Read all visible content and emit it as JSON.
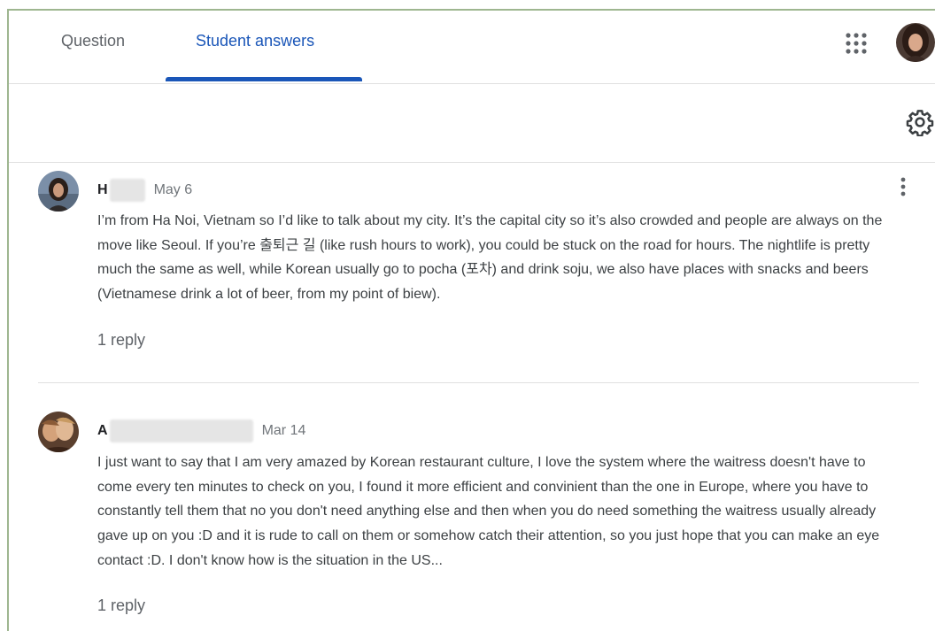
{
  "tabs": {
    "question": "Question",
    "student_answers": "Student answers",
    "active": "student_answers"
  },
  "icons": {
    "apps": "apps-grid-icon",
    "settings": "settings-gear-icon",
    "more": "more-vertical-icon",
    "user_avatar": "user-avatar-photo"
  },
  "colors": {
    "accent": "#1a56b8",
    "text": "#3c4043",
    "muted": "#5f6368",
    "frame_border": "#9eb690"
  },
  "posts": [
    {
      "author_initial": "H",
      "date": "May 6",
      "body": "I’m from Ha Noi, Vietnam so I’d like to talk about my city. It’s the capital city so it’s also crowded and people are always on the move like Seoul. If you’re 출퇴근 길 (like rush hours to work), you could be stuck on the road for hours. The nightlife is pretty much the same as well, while Korean usually go to pocha (포차) and drink soju, we also have places with snacks and beers (Vietnamese drink a lot of beer, from my point of biew).",
      "replies": "1 reply"
    },
    {
      "author_initial": "A",
      "date": "Mar 14",
      "body": "I just want to say that I am very amazed by Korean restaurant culture, I love the system where the waitress doesn't have to come every ten minutes to check on you, I found it more efficient and convinient than the one in Europe, where you have to constantly tell them that no you don't need anything else and then when you do need something the waitress usually already gave up on you :D and it is rude to call on them or somehow catch their attention, so you just hope that you can make an eye contact :D.  I don't know how is the situation in the US...",
      "replies": "1 reply"
    }
  ]
}
